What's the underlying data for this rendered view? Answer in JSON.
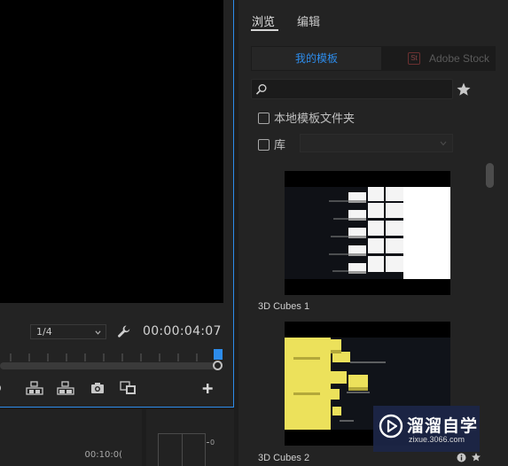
{
  "program_monitor": {
    "zoom_value": "1/4",
    "timecode": "00:00:04:07"
  },
  "timeline": {
    "time_label": "00:10:0("
  },
  "audio_meter": {
    "zero_label": "0"
  },
  "essential_graphics": {
    "tabs": {
      "browse": "浏览",
      "edit": "编辑"
    },
    "segments": {
      "my_templates": "我的模板",
      "adobe_stock": "Adobe Stock",
      "stock_logo": "St"
    },
    "local_templates_folder": "本地模板文件夹",
    "library_label": "库",
    "templates": [
      {
        "name": "3D Cubes 1"
      },
      {
        "name": "3D Cubes 2"
      }
    ]
  },
  "watermark": {
    "title": "溜溜自学",
    "subtitle": "zixue.3066.com"
  },
  "colors": {
    "accent": "#2d8ceb",
    "panel_bg": "#232323",
    "cube_yellow": "#ece15b"
  }
}
